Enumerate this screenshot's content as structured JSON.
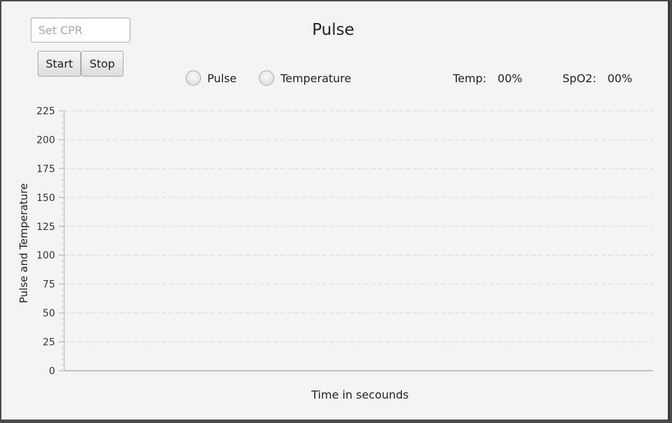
{
  "controls": {
    "cpr_placeholder": "Set CPR",
    "start_label": "Start",
    "stop_label": "Stop"
  },
  "header": {
    "title": "Pulse"
  },
  "radios": [
    {
      "label": "Pulse",
      "checked": false
    },
    {
      "label": "Temperature",
      "checked": false
    }
  ],
  "readouts": {
    "temp_label": "Temp:",
    "temp_value": "00%",
    "spo2_label": "SpO2:",
    "spo2_value": "00%"
  },
  "chart_data": {
    "type": "line",
    "title": "",
    "xlabel": "Time in secounds",
    "ylabel": "Pulse and Temperature",
    "ylim": [
      0,
      225
    ],
    "yticks": [
      0,
      25,
      50,
      75,
      100,
      125,
      150,
      175,
      200,
      225
    ],
    "grid": true,
    "series": []
  },
  "colors": {
    "background": "#f4f4f4",
    "grid": "#dcdcdc",
    "axis": "#b0b0b0"
  }
}
